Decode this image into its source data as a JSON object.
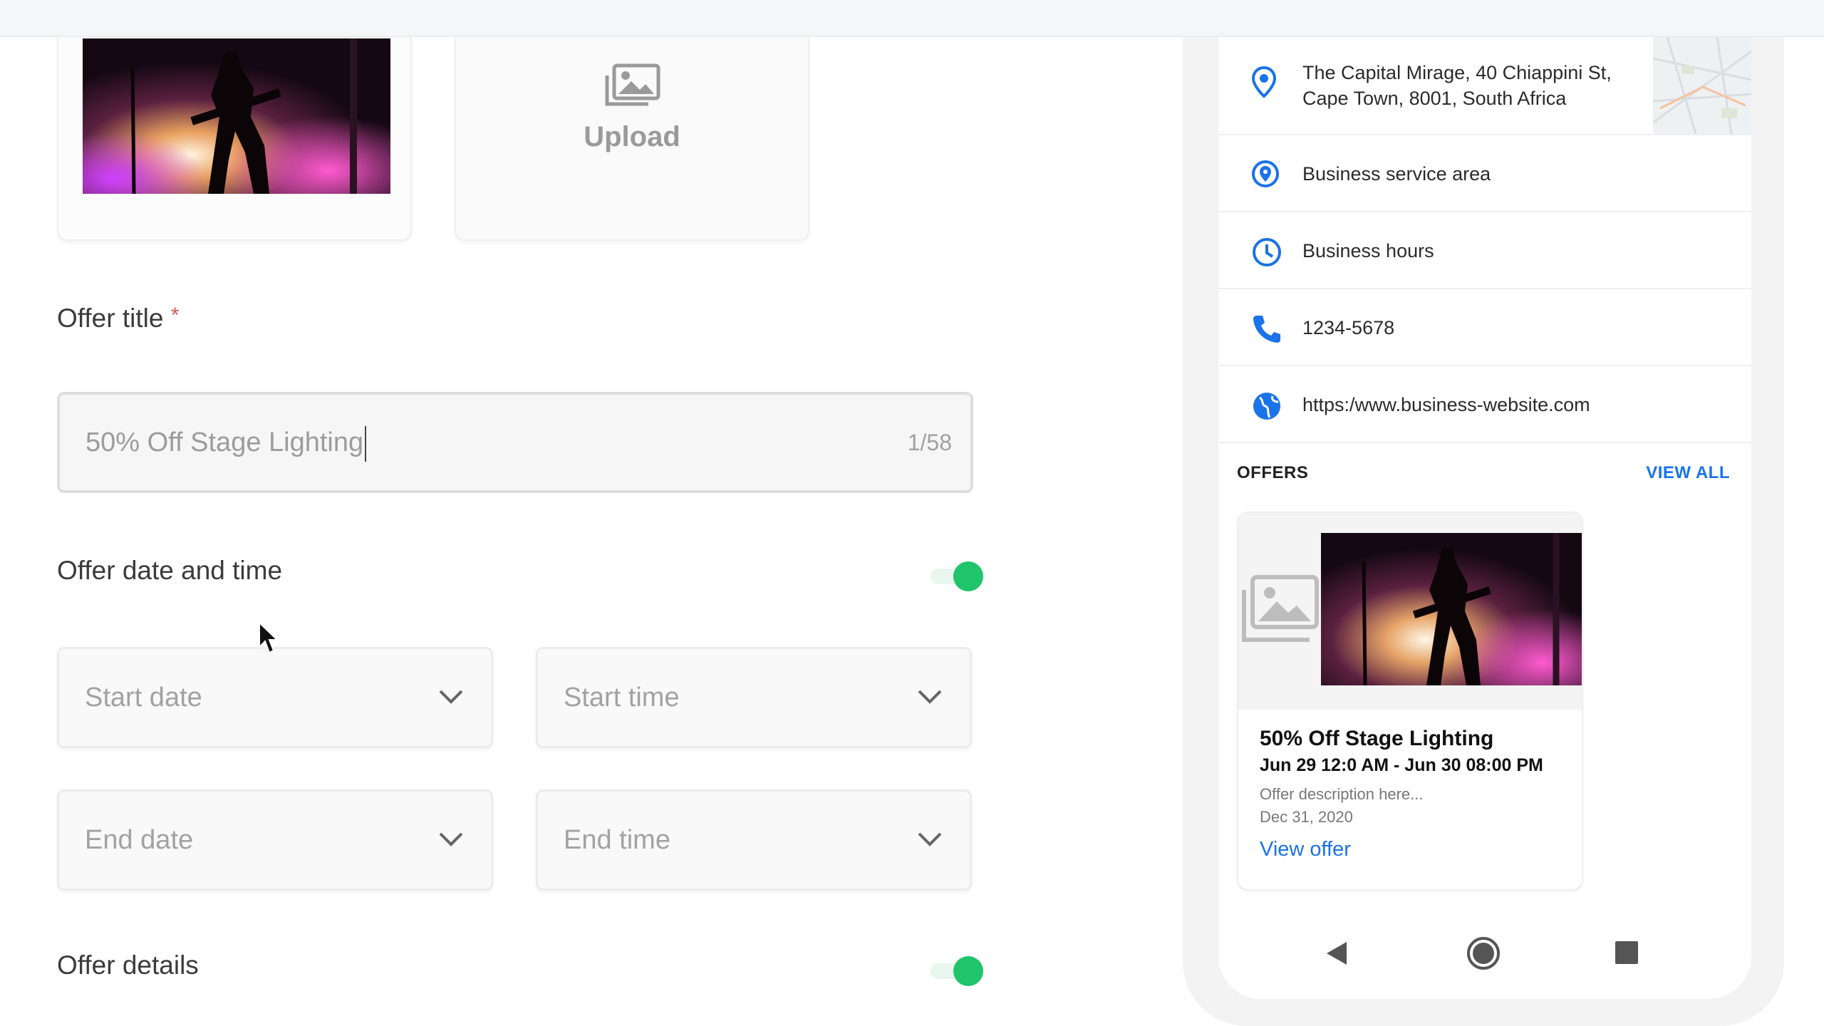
{
  "editor": {
    "upload_label": "Upload",
    "offer_title_label": "Offer title",
    "required_mark": "*",
    "offer_title_value": "50% Off Stage Lighting",
    "char_counter": "1/58",
    "date_time_label": "Offer date and time",
    "date_time_enabled": true,
    "start_date_placeholder": "Start date",
    "start_time_placeholder": "Start time",
    "end_date_placeholder": "End date",
    "end_time_placeholder": "End time",
    "details_label": "Offer details",
    "details_enabled": true,
    "accent_color": "#20c46a"
  },
  "preview": {
    "address": "The Capital Mirage, 40 Chiappini St, Cape Town, 8001, South Africa",
    "service_area": "Business service area",
    "hours": "Business hours",
    "phone": "1234-5678",
    "website": "https:/www.business-website.com",
    "offers_heading": "OFFERS",
    "view_all": "VIEW ALL",
    "offer": {
      "title": "50% Off Stage Lighting",
      "dates": "Jun 29 12:0 AM - Jun 30 08:00 PM",
      "description": "Offer description here...",
      "expiry": "Dec 31, 2020",
      "link": "View offer"
    },
    "icons": [
      "location-pin-icon",
      "service-area-icon",
      "clock-icon",
      "phone-icon",
      "globe-icon"
    ],
    "link_color": "#1a73e8"
  }
}
